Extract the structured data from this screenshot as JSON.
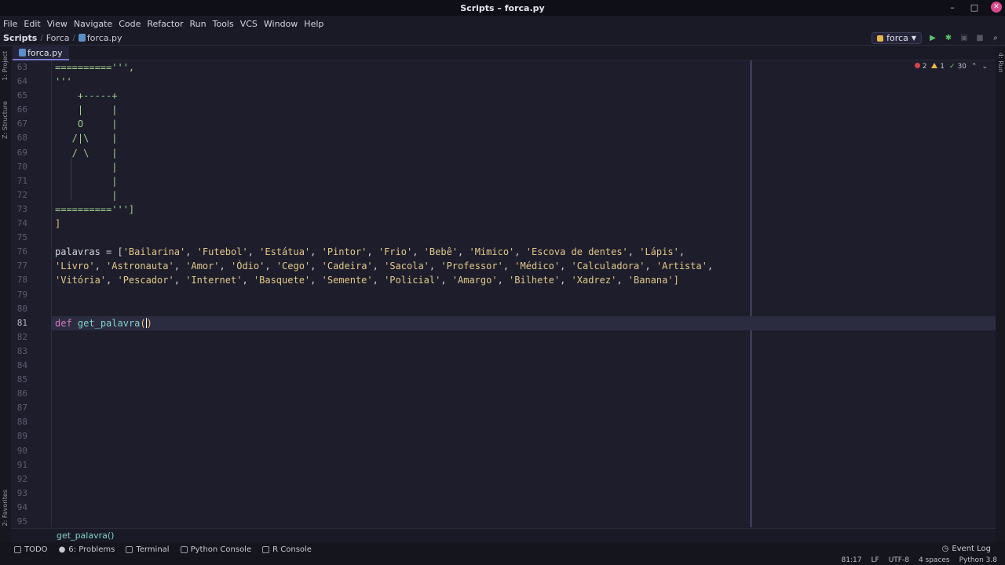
{
  "window": {
    "title": "Scripts – forca.py"
  },
  "menu": [
    "File",
    "Edit",
    "View",
    "Navigate",
    "Code",
    "Refactor",
    "Run",
    "Tools",
    "VCS",
    "Window",
    "Help"
  ],
  "nav": {
    "project": "Scripts",
    "folder": "Forca",
    "file": "forca.py"
  },
  "run_config": {
    "label": "forca"
  },
  "tab": {
    "label": "forca.py"
  },
  "inspections": {
    "errors": "2",
    "warnings": "1",
    "weak": "30"
  },
  "left_tools": [
    "1: Project",
    "Z: Structure",
    "2: Favorites"
  ],
  "right_tools": [
    "4: Run"
  ],
  "line_numbers": [
    "63",
    "64",
    "65",
    "66",
    "67",
    "68",
    "69",
    "70",
    "71",
    "72",
    "73",
    "74",
    "75",
    "76",
    "77",
    "78",
    "79",
    "80",
    "81",
    "82",
    "83",
    "84",
    "85",
    "86",
    "87",
    "88",
    "89",
    "90",
    "91",
    "92",
    "93",
    "94",
    "95"
  ],
  "active_line": "81",
  "code": {
    "l63": "==========''',",
    "l64": "'''",
    "l65": "    +-----+",
    "l66": "    |     |",
    "l67": "    O     |",
    "l68": "   /|\\    |",
    "l69": "   / \\    |",
    "l70": "          |",
    "l71": "          |",
    "l72": "          |",
    "l73": "==========''']",
    "l74": "]",
    "l76_var": "palavras",
    "l76_op": " = [",
    "l76_items": [
      "'Bailarina'",
      "'Futebol'",
      "'Estátua'",
      "'Pintor'",
      "'Frio'",
      "'Bebê'",
      "'Mimico'",
      "'Escova de dentes'",
      "'Lápis'"
    ],
    "l77_items": [
      "'Livro'",
      "'Astronauta'",
      "'Amor'",
      "'Ódio'",
      "'Cego'",
      "'Cadeira'",
      "'Sacola'",
      "'Professor'",
      "'Médico'",
      "'Calculadora'",
      "'Artista'"
    ],
    "l78_items": [
      "'Vitória'",
      "'Pescador'",
      "'Internet'",
      "'Basquete'",
      "'Semente'",
      "'Policial'",
      "'Amargo'",
      "'Bilhete'",
      "'Xadrez'",
      "'Banana'"
    ],
    "l81_kw": "def",
    "l81_fn": "get_palavra",
    "l81_paren_open": "(",
    "l81_paren_close": ")"
  },
  "breadcrumb_status": "get_palavra()",
  "tool_windows": [
    "TODO",
    "6: Problems",
    "Terminal",
    "Python Console",
    "R Console"
  ],
  "event_log": "Event Log",
  "status": {
    "position": "81:17",
    "line_sep": "LF",
    "encoding": "UTF-8",
    "indent": "4 spaces",
    "interpreter": "Python 3.8"
  }
}
